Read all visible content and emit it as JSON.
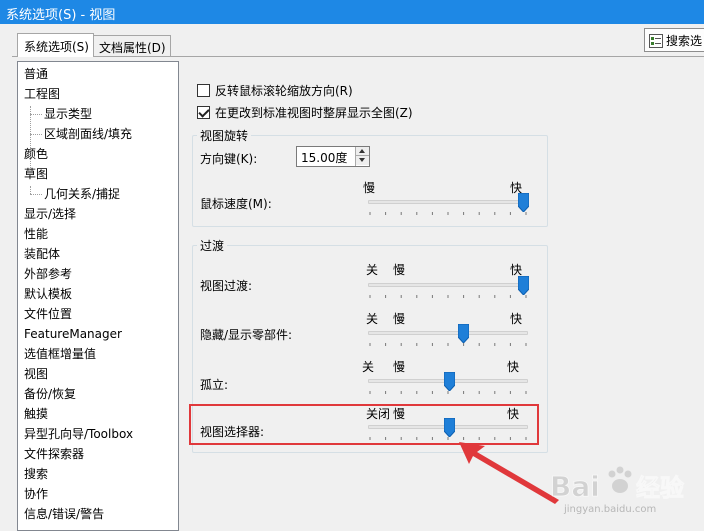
{
  "window": {
    "title": "系统选项(S) - 视图"
  },
  "tabs": [
    {
      "label": "系统选项(S)",
      "active": true
    },
    {
      "label": "文档属性(D)",
      "active": false
    }
  ],
  "search": {
    "label": "搜索选",
    "icon": "search-options-icon"
  },
  "nav": {
    "items": [
      {
        "label": "普通",
        "level": 0
      },
      {
        "label": "工程图",
        "level": 0
      },
      {
        "label": "显示类型",
        "level": 1
      },
      {
        "label": "区域剖面线/填充",
        "level": 1
      },
      {
        "label": "颜色",
        "level": 0
      },
      {
        "label": "草图",
        "level": 0
      },
      {
        "label": "几何关系/捕捉",
        "level": 1
      },
      {
        "label": "显示/选择",
        "level": 0
      },
      {
        "label": "性能",
        "level": 0
      },
      {
        "label": "装配体",
        "level": 0
      },
      {
        "label": "外部参考",
        "level": 0
      },
      {
        "label": "默认模板",
        "level": 0
      },
      {
        "label": "文件位置",
        "level": 0
      },
      {
        "label": "FeatureManager",
        "level": 0
      },
      {
        "label": "选值框增量值",
        "level": 0
      },
      {
        "label": "视图",
        "level": 0,
        "selected": true
      },
      {
        "label": "备份/恢复",
        "level": 0
      },
      {
        "label": "触摸",
        "level": 0
      },
      {
        "label": "异型孔向导/Toolbox",
        "level": 0
      },
      {
        "label": "文件探索器",
        "level": 0
      },
      {
        "label": "搜索",
        "level": 0
      },
      {
        "label": "协作",
        "level": 0
      },
      {
        "label": "信息/错误/警告",
        "level": 0
      }
    ]
  },
  "options": {
    "reverse_wheel": {
      "label": "反转鼠标滚轮缩放方向(R)",
      "checked": false
    },
    "zoom_to_fit": {
      "label": "在更改到标准视图时整屏显示全图(Z)",
      "checked": true
    }
  },
  "view_rotation": {
    "title": "视图旋转",
    "arrow_keys_label": "方向键(K):",
    "arrow_keys_value": "15.00度",
    "mouse_speed_label": "鼠标速度(M):",
    "slow_label": "慢",
    "fast_label": "快",
    "mouse_speed_level": 1.0
  },
  "transitions": {
    "title": "过渡",
    "off_label": "关",
    "slow_label": "慢",
    "fast_label": "快",
    "view_transition": {
      "label": "视图过渡:",
      "level": 1.0
    },
    "hide_show": {
      "label": "隐藏/显示零部件:",
      "level": 0.6
    },
    "isolate": {
      "label": "孤立:",
      "level": 0.5
    },
    "view_selector": {
      "label": "视图选择器:",
      "off_label": "关闭",
      "level": 0.5
    }
  },
  "annotation": {
    "color": "#e0383b"
  },
  "watermark": {
    "text": "Bai",
    "text2": "经验",
    "url": "jingyan.baidu.com"
  },
  "colors": {
    "titlebar": "#1e88e5",
    "thumb": "#1f7fd8"
  }
}
